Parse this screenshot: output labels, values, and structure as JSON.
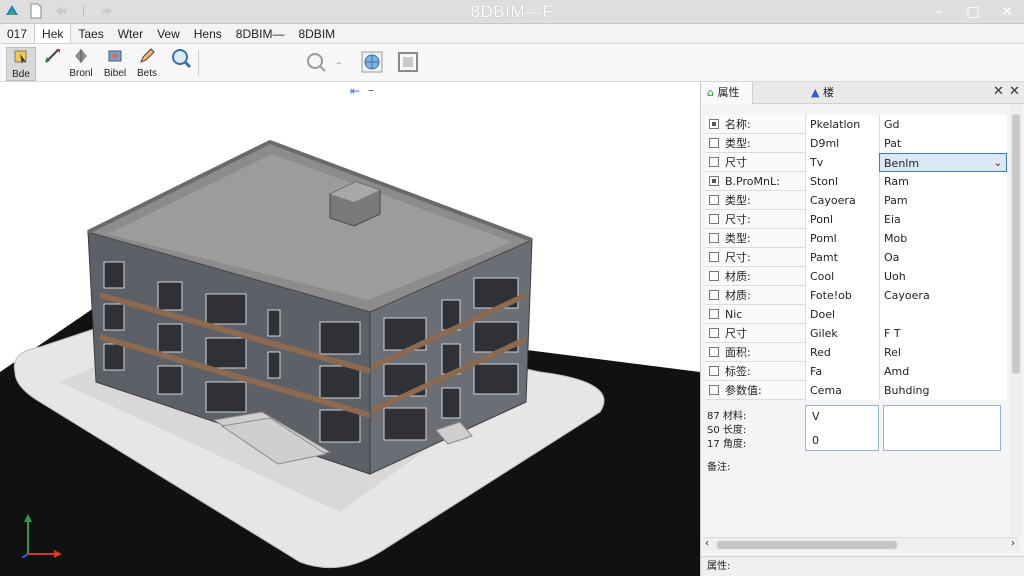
{
  "window": {
    "title": "8DBIM—F",
    "minimize": "–",
    "maximize": "□",
    "close": "✕"
  },
  "menu": [
    {
      "label": "017"
    },
    {
      "label": "Hek"
    },
    {
      "label": "Taes"
    },
    {
      "label": "Wter"
    },
    {
      "label": "Vew"
    },
    {
      "label": "Hens"
    },
    {
      "label": "8DBIM—"
    },
    {
      "label": "8DBIM"
    }
  ],
  "ribbon": {
    "buttons": [
      {
        "label": "Bde",
        "icon": "select-icon"
      },
      {
        "label": "",
        "icon": "move-icon"
      },
      {
        "label": "Bronl",
        "icon": "rotate-icon"
      },
      {
        "label": "Bibel",
        "icon": "layers-icon"
      },
      {
        "label": "Bets",
        "icon": "edit-icon"
      },
      {
        "label": "",
        "icon": "zoom-fit-icon"
      }
    ],
    "zoom_dash": "–",
    "view_tools": [
      "zoom-icon",
      "globe-icon",
      "frame-icon"
    ]
  },
  "viewport": {
    "nav_hint": "–"
  },
  "panel": {
    "tabs": [
      {
        "label": "属性"
      },
      {
        "label": "楼"
      }
    ],
    "rows": [
      {
        "checked": true,
        "name": "名称:",
        "value": "Pkelatlon",
        "extra": "Gd"
      },
      {
        "checked": false,
        "name": "类型:",
        "value": "D9ml",
        "extra": "Pat"
      },
      {
        "checked": false,
        "name": "尺寸",
        "value": "Tv",
        "extra": "Benlm",
        "dropdown": true
      },
      {
        "checked": true,
        "name": "B.ProMnL:",
        "value": "Stonl",
        "extra": "Ram"
      },
      {
        "checked": false,
        "name": "类型:",
        "value": "Cayoera",
        "extra": "Pam"
      },
      {
        "checked": false,
        "name": "尺寸:",
        "value": "Ponl",
        "extra": "Eia"
      },
      {
        "checked": false,
        "name": "类型:",
        "value": "Poml",
        "extra": "Mob"
      },
      {
        "checked": false,
        "name": "尺寸:",
        "value": "Pamt",
        "extra": "Oa"
      },
      {
        "checked": false,
        "name": "材质:",
        "value": "Cool",
        "extra": "Uoh"
      },
      {
        "checked": false,
        "name": "材质:",
        "value": "Fote!ob",
        "extra": "Cayoera"
      },
      {
        "checked": false,
        "name": "Nic",
        "value": "Doel",
        "extra": ""
      },
      {
        "checked": false,
        "name": "尺寸",
        "value": "Gilek",
        "extra": "F T"
      },
      {
        "checked": false,
        "name": "面积:",
        "value": "Red",
        "extra": "Rel"
      },
      {
        "checked": false,
        "name": "标签:",
        "value": "Fa",
        "extra": "Amd"
      },
      {
        "checked": false,
        "name": "参数值:",
        "value": "Cema",
        "extra": "Buhding"
      }
    ],
    "multi": {
      "labels": [
        "87 材料:",
        "S0 长度:",
        "17 角度:"
      ],
      "value_lines": [
        "V",
        "0"
      ]
    },
    "notes_label": "备注:",
    "status_label": "属性:"
  },
  "colors": {
    "accent": "#3c78c8",
    "ground": "#111111",
    "building": "#5c5f66"
  }
}
